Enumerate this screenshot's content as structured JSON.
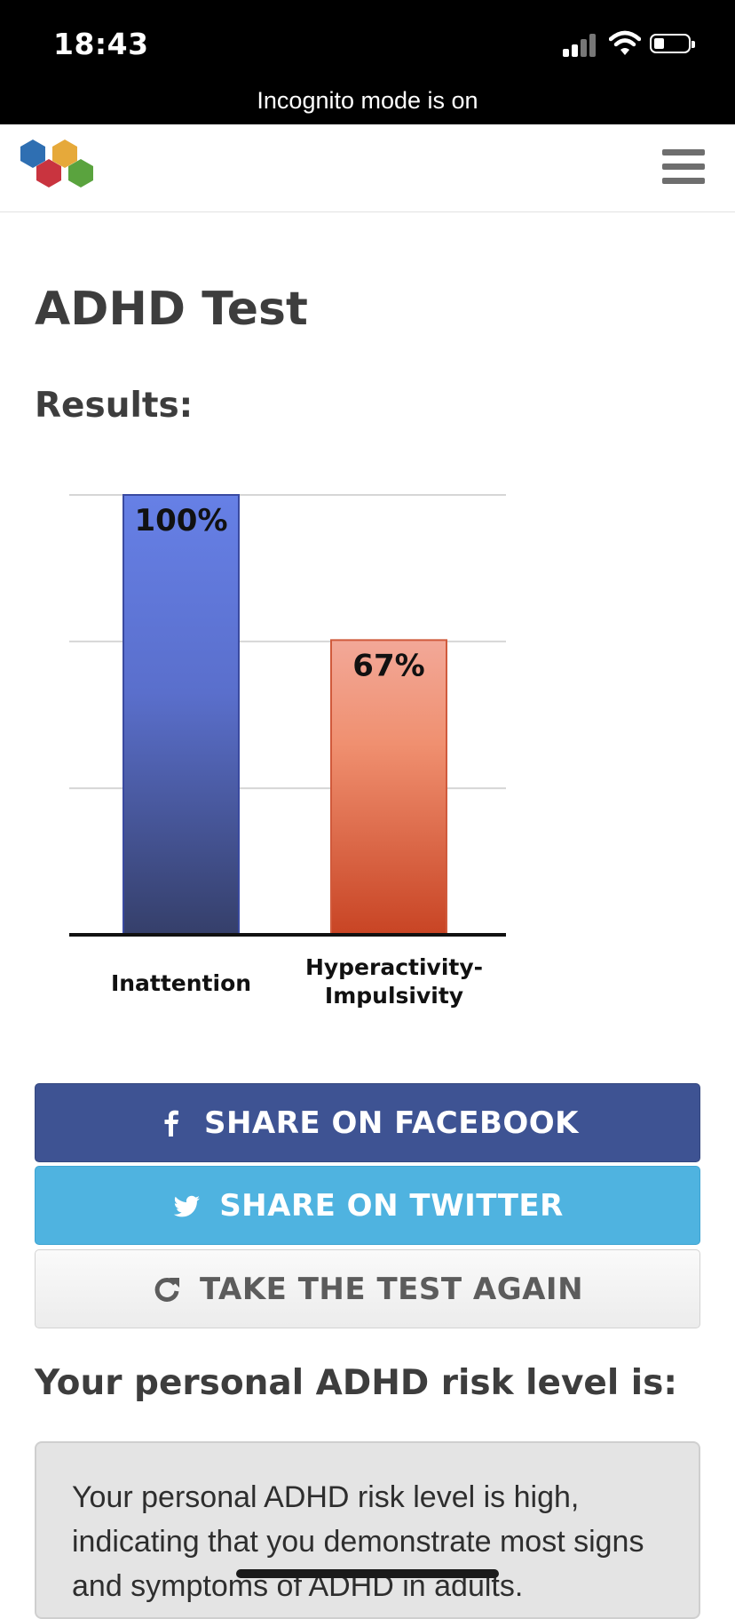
{
  "status_bar": {
    "time": "18:43",
    "banner": "Incognito mode is on"
  },
  "header": {
    "logo_icon": "hexagon-cluster-logo",
    "menu_icon": "hamburger-menu-icon"
  },
  "page": {
    "title": "ADHD Test",
    "results_label": "Results:"
  },
  "chart_data": {
    "type": "bar",
    "categories": [
      "Inattention",
      "Hyperactivity-\nImpulsivity"
    ],
    "category_lines": [
      [
        "Inattention"
      ],
      [
        "Hyperactivity-",
        "Impulsivity"
      ]
    ],
    "values": [
      100,
      67
    ],
    "value_labels": [
      "100%",
      "67%"
    ],
    "ylim": [
      0,
      100
    ],
    "gridlines": [
      33.3,
      66.7,
      100
    ],
    "grid": true,
    "colors": [
      "#6680e6",
      "#f0a080"
    ]
  },
  "buttons": {
    "facebook": {
      "label": "SHARE ON FACEBOOK",
      "icon": "facebook-icon",
      "color": "#3e5393"
    },
    "twitter": {
      "label": "SHARE ON TWITTER",
      "icon": "twitter-icon",
      "color": "#4fb3e0"
    },
    "again": {
      "label": "TAKE THE TEST AGAIN",
      "icon": "refresh-icon"
    }
  },
  "risk": {
    "heading": "Your personal ADHD risk level is:",
    "text": "Your personal ADHD risk level is high, indicating that you demonstrate most signs and symptoms of ADHD in adults."
  }
}
